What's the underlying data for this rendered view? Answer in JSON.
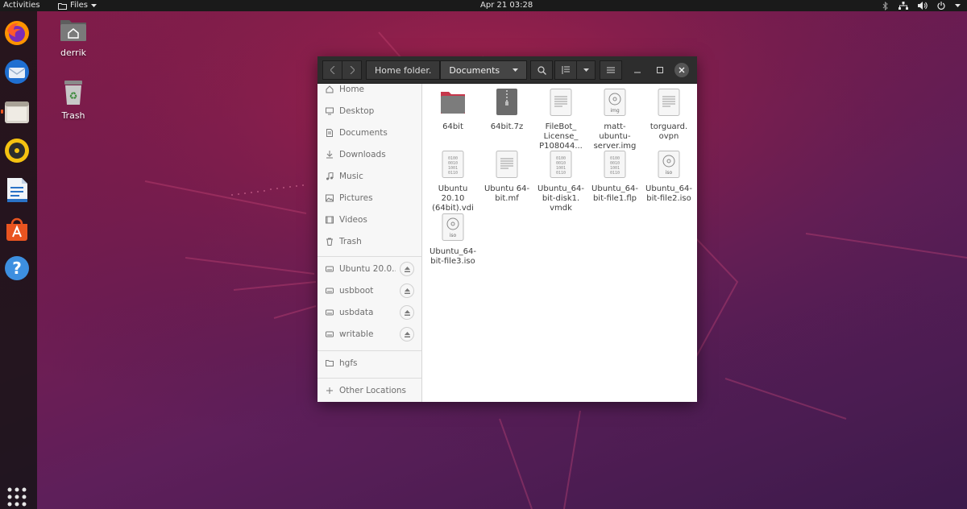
{
  "topbar": {
    "activities": "Activities",
    "app_menu": "Files",
    "clock": "Apr 21  03:28"
  },
  "dock": {
    "items": [
      {
        "name": "firefox-icon"
      },
      {
        "name": "thunderbird-icon"
      },
      {
        "name": "files-icon"
      },
      {
        "name": "rhythmbox-icon"
      },
      {
        "name": "libreoffice-writer-icon"
      },
      {
        "name": "software-center-icon"
      },
      {
        "name": "help-icon"
      },
      {
        "name": "show-applications-icon"
      }
    ]
  },
  "desktop": {
    "icons": [
      {
        "label": "derrik",
        "icon": "home-folder-icon"
      },
      {
        "label": "Trash",
        "icon": "trash-icon"
      }
    ]
  },
  "window": {
    "path": [
      "Home folder.",
      "Documents"
    ],
    "sidebar": {
      "places": [
        "Home",
        "Desktop",
        "Documents",
        "Downloads",
        "Music",
        "Pictures",
        "Videos",
        "Trash"
      ],
      "devices": [
        "Ubuntu 20.0...",
        "usbboot",
        "usbdata",
        "writable"
      ],
      "network": [
        "hgfs"
      ],
      "other": "Other Locations"
    },
    "files": [
      {
        "name": "64bit",
        "type": "folder"
      },
      {
        "name": "64bit.7z",
        "type": "archive"
      },
      {
        "name": "FileBot_ License_ P108044...",
        "type": "text"
      },
      {
        "name": "matt- ubuntu- server.img",
        "type": "disk-image",
        "badge": "img"
      },
      {
        "name": "torguard. ovpn",
        "type": "text"
      },
      {
        "name": "Ubuntu 20.10 (64bit).vdi",
        "type": "binary"
      },
      {
        "name": "Ubuntu 64- bit.mf",
        "type": "text"
      },
      {
        "name": "Ubuntu_64- bit-disk1. vmdk",
        "type": "binary"
      },
      {
        "name": "Ubuntu_64- bit-file1.flp",
        "type": "binary"
      },
      {
        "name": "Ubuntu_64- bit-file2.iso",
        "type": "disk-image",
        "badge": "iso"
      },
      {
        "name": "Ubuntu_64- bit-file3.iso",
        "type": "disk-image",
        "badge": "iso"
      }
    ]
  },
  "colors": {
    "accent": "#e95420",
    "headerbar": "#2d2d2d",
    "sidebar": "#f7f7f7"
  }
}
